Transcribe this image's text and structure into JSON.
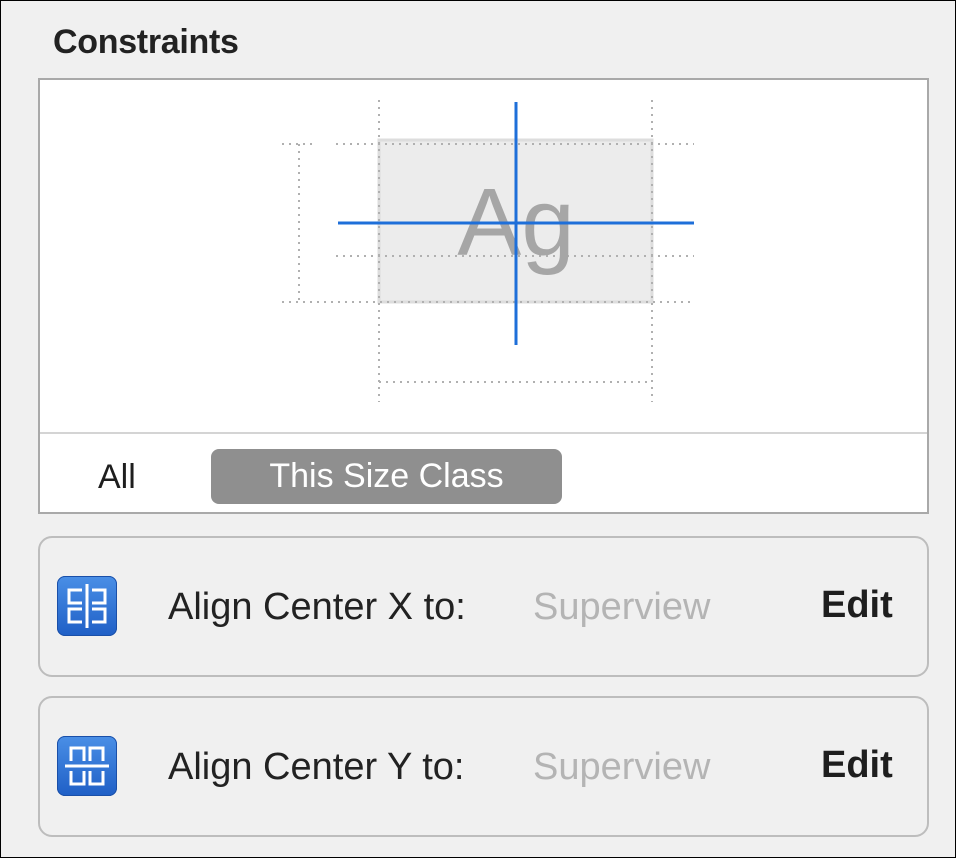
{
  "panel": {
    "title": "Constraints"
  },
  "preview": {
    "sample_text": "Ag",
    "accent_color": "#1e6fd9"
  },
  "filter": {
    "options": [
      "All",
      "This Size Class"
    ],
    "selected": "This Size Class"
  },
  "constraints": [
    {
      "icon": "align-center-x-icon",
      "label": "Align Center X to:",
      "target": "Superview",
      "action": "Edit"
    },
    {
      "icon": "align-center-y-icon",
      "label": "Align Center Y to:",
      "target": "Superview",
      "action": "Edit"
    }
  ]
}
